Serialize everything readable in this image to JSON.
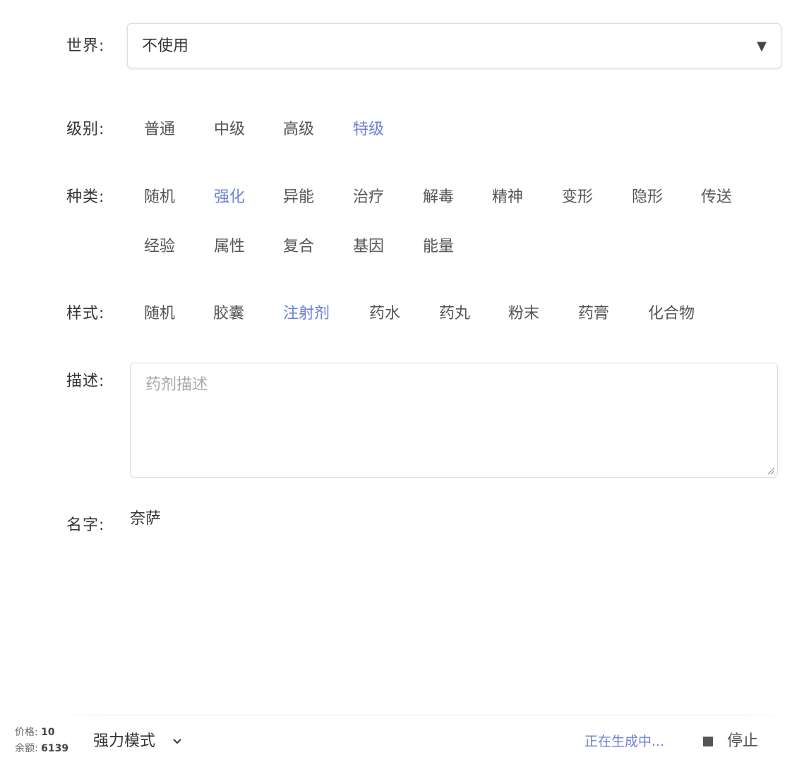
{
  "world": {
    "label": "世界:",
    "selected": "不使用",
    "arrow_icon": "▼"
  },
  "level": {
    "label": "级别:",
    "options": [
      "普通",
      "中级",
      "高级",
      "特级"
    ],
    "selected": "特级"
  },
  "category": {
    "label": "种类:",
    "options": [
      "随机",
      "强化",
      "异能",
      "治疗",
      "解毒",
      "精神",
      "变形",
      "隐形",
      "传送",
      "经验",
      "属性",
      "复合",
      "基因",
      "能量"
    ],
    "selected": "强化"
  },
  "style": {
    "label": "样式:",
    "options": [
      "随机",
      "胶囊",
      "注射剂",
      "药水",
      "药丸",
      "粉末",
      "药膏",
      "化合物"
    ],
    "selected": "注射剂"
  },
  "description": {
    "label": "描述:",
    "placeholder": "药剂描述",
    "value": ""
  },
  "name": {
    "label": "名字:",
    "value": "奈萨"
  },
  "footer": {
    "price_label": "价格:",
    "price_value": "10",
    "balance_label": "余额:",
    "balance_value": "6139",
    "mode_label": "强力模式",
    "status_text": "正在生成中...",
    "stop_label": "停止"
  },
  "colors": {
    "accent": "#6b7fd6",
    "text": "#333333",
    "option_text": "#555555",
    "placeholder": "#a8a8a8",
    "border": "#dcdcdc"
  }
}
